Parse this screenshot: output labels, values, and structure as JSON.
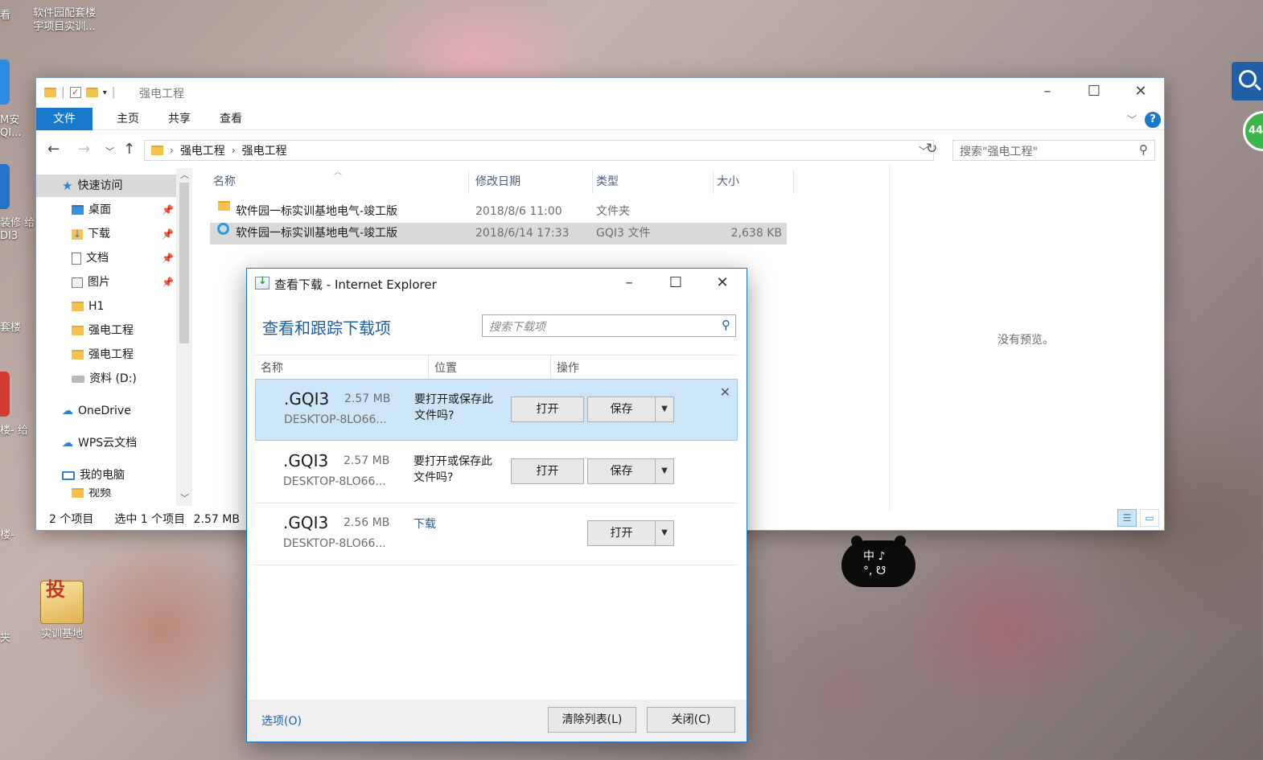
{
  "desktop": {
    "icons": [
      {
        "label": "软件园配套楼\n宇项目实训...",
        "id": "top"
      },
      {
        "label": "实训基地",
        "id": "bottom"
      }
    ],
    "edge_labels": [
      "看",
      "M安",
      "QI...",
      "装修 给",
      "DI3",
      "套楼",
      "楼- 给",
      "楼-",
      "夹"
    ],
    "search_widget_icon": "search-icon",
    "badge_text": "44",
    "ime_text_line1": "中 ♪",
    "ime_text_line2": "°, ☋"
  },
  "explorer": {
    "title": "强电工程",
    "ribbon_tabs": [
      "文件",
      "主页",
      "共享",
      "查看"
    ],
    "breadcrumb": [
      "强电工程",
      "强电工程"
    ],
    "search_placeholder": "搜索\"强电工程\"",
    "nav": {
      "quick_access": "快速访问",
      "items": [
        "桌面",
        "下载",
        "文档",
        "图片",
        "H1",
        "强电工程",
        "强电工程",
        "资料 (D:)"
      ],
      "onedrive": "OneDrive",
      "wps": "WPS云文档",
      "this_pc": "我的电脑",
      "partial": "视频"
    },
    "columns": [
      "名称",
      "修改日期",
      "类型",
      "大小"
    ],
    "files": [
      {
        "name": "软件园一标实训基地电气-竣工版",
        "date": "2018/8/6 11:00",
        "type": "文件夹",
        "size": ""
      },
      {
        "name": "软件园一标实训基地电气-竣工版",
        "date": "2018/6/14 17:33",
        "type": "GQI3 文件",
        "size": "2,638 KB"
      }
    ],
    "preview_text": "没有预览。",
    "status": {
      "count": "2 个项目",
      "selected": "选中 1 个项目",
      "size": "2.57 MB"
    }
  },
  "ie_dialog": {
    "title": "查看下载 - Internet Explorer",
    "heading": "查看和跟踪下载项",
    "search_placeholder": "搜索下载项",
    "columns": [
      "名称",
      "位置",
      "操作"
    ],
    "downloads": [
      {
        "name": ".GQI3",
        "size": "2.57 MB",
        "source": "DESKTOP-8LO66...",
        "prompt": "要打开或保存此文件吗?",
        "open": "打开",
        "save": "保存"
      },
      {
        "name": ".GQI3",
        "size": "2.57 MB",
        "source": "DESKTOP-8LO66...",
        "prompt": "要打开或保存此文件吗?",
        "open": "打开",
        "save": "保存"
      },
      {
        "name": ".GQI3",
        "size": "2.56 MB",
        "source": "DESKTOP-8LO66...",
        "link": "下载",
        "open": "打开"
      }
    ],
    "options_link": "选项(O)",
    "clear_button": "清除列表(L)",
    "close_button": "关闭(C)"
  }
}
